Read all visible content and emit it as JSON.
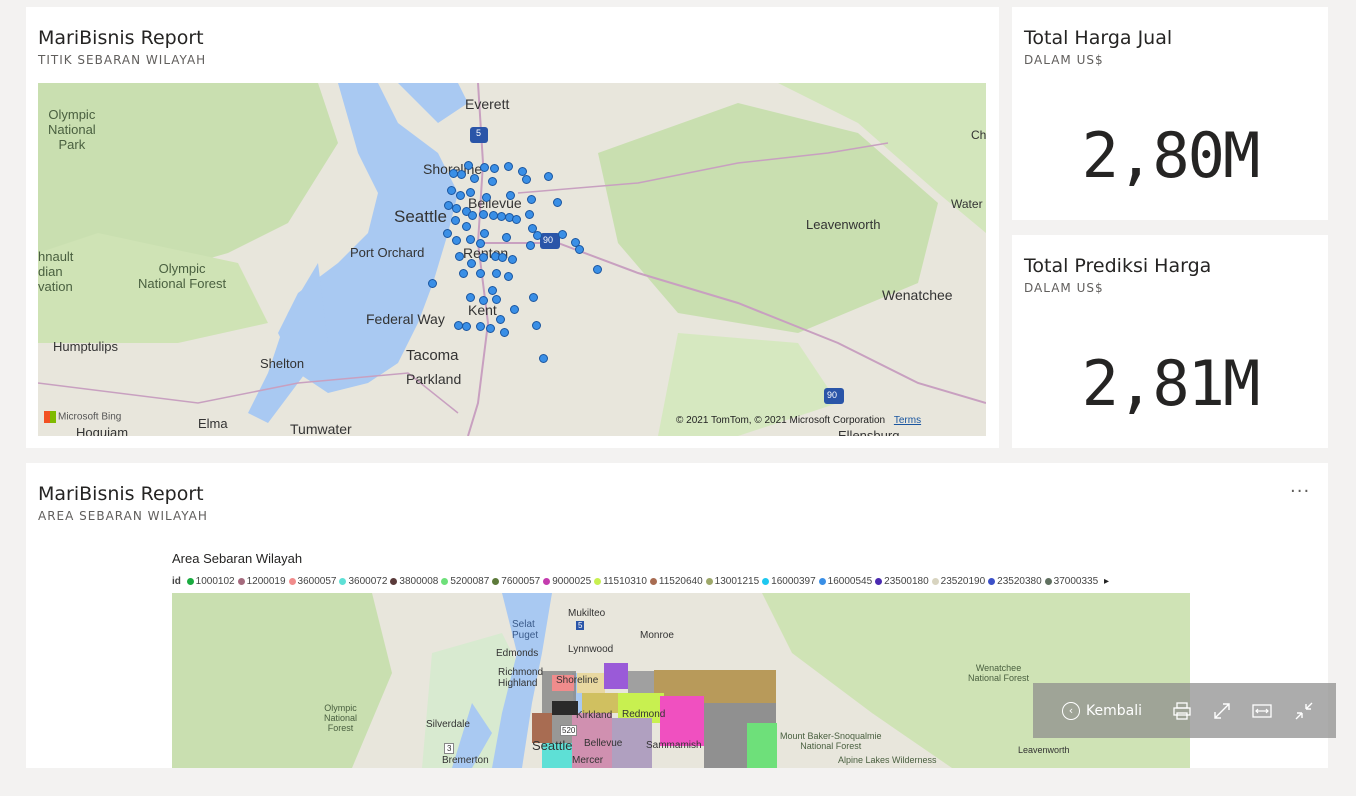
{
  "map_report": {
    "title": "MariBisnis Report",
    "subtitle": "TITIK SEBARAN WILAYAH",
    "labels": {
      "everett": "Everett",
      "olympic_np": "Olympic\nNational\nPark",
      "shoreline": "Shoreline",
      "bellevue": "Bellevue",
      "seattle": "Seattle",
      "port_orchard": "Port Orchard",
      "renton": "Renton",
      "olympic_forest": "Olympic\nNational Forest",
      "federal_way": "Federal Way",
      "kent": "Kent",
      "humptulips": "Humptulips",
      "shelton": "Shelton",
      "tacoma": "Tacoma",
      "parkland": "Parkland",
      "elma": "Elma",
      "hoquiam": "Hoquiam",
      "tumwater": "Tumwater",
      "leavenworth": "Leavenworth",
      "wenatchee": "Wenatchee",
      "water": "Water",
      "ch": "Ch",
      "ellensburg": "Ellensburg",
      "edge_left": "hnault\ndian\nvation",
      "i5": "5",
      "i90": "90",
      "i90b": "90"
    },
    "bing": "Microsoft Bing",
    "copyright": "© 2021 TomTom, © 2021 Microsoft Corporation",
    "terms": "Terms"
  },
  "kpi_sales": {
    "title": "Total Harga Jual",
    "subtitle": "DALAM US$",
    "value": "2,80M"
  },
  "kpi_prediction": {
    "title": "Total Prediksi Harga",
    "subtitle": "DALAM US$",
    "value": "2,81M"
  },
  "area_report": {
    "title": "MariBisnis Report",
    "subtitle": "AREA SEBARAN WILAYAH",
    "ellipsis": "···",
    "chart_title": "Area Sebaran Wilayah",
    "legend_label": "id",
    "legend": [
      {
        "id": "1000102",
        "color": "#1aab40"
      },
      {
        "id": "1200019",
        "color": "#a56b7e"
      },
      {
        "id": "3600057",
        "color": "#f08c8c"
      },
      {
        "id": "3600072",
        "color": "#5ee0d6"
      },
      {
        "id": "3800008",
        "color": "#5a3a3a"
      },
      {
        "id": "5200087",
        "color": "#6ee07a"
      },
      {
        "id": "7600057",
        "color": "#5d7a3a"
      },
      {
        "id": "9000025",
        "color": "#c43cae"
      },
      {
        "id": "11510310",
        "color": "#c8f050"
      },
      {
        "id": "11520640",
        "color": "#a86c52"
      },
      {
        "id": "13001215",
        "color": "#9ea86a"
      },
      {
        "id": "16000397",
        "color": "#1ec8f0"
      },
      {
        "id": "16000545",
        "color": "#3a8fe6"
      },
      {
        "id": "23500180",
        "color": "#4a2ab0"
      },
      {
        "id": "23520190",
        "color": "#d8d4c0"
      },
      {
        "id": "23520380",
        "color": "#3c50c8"
      },
      {
        "id": "37000335",
        "color": "#607060"
      }
    ],
    "labels": {
      "mukilteo": "Mukilteo",
      "selat_puget": "Selat\nPuget",
      "monroe": "Monroe",
      "edmonds": "Edmonds",
      "lynnwood": "Lynnwood",
      "richmond": "Richmond\nHighland",
      "shoreline": "Shoreline",
      "kirkland": "Kirkland",
      "redmond": "Redmond",
      "silverdale": "Silverdale",
      "seattle": "Seattle",
      "bellevue": "Bellevue",
      "sammamish": "Sammamish",
      "bremerton": "Bremerton",
      "mercer": "Mercer",
      "olympic_forest": "Olympic\nNational\nForest",
      "wenatchee_forest": "Wenatchee\nNational Forest",
      "mt_baker": "Mount Baker-Snoqualmie\nNational Forest",
      "alpine": "Alpine Lakes Wilderness",
      "leavenworth": "Leavenworth",
      "i520": "520",
      "i3": "3",
      "i5": "5"
    }
  },
  "toolbar": {
    "back_label": "Kembali"
  }
}
